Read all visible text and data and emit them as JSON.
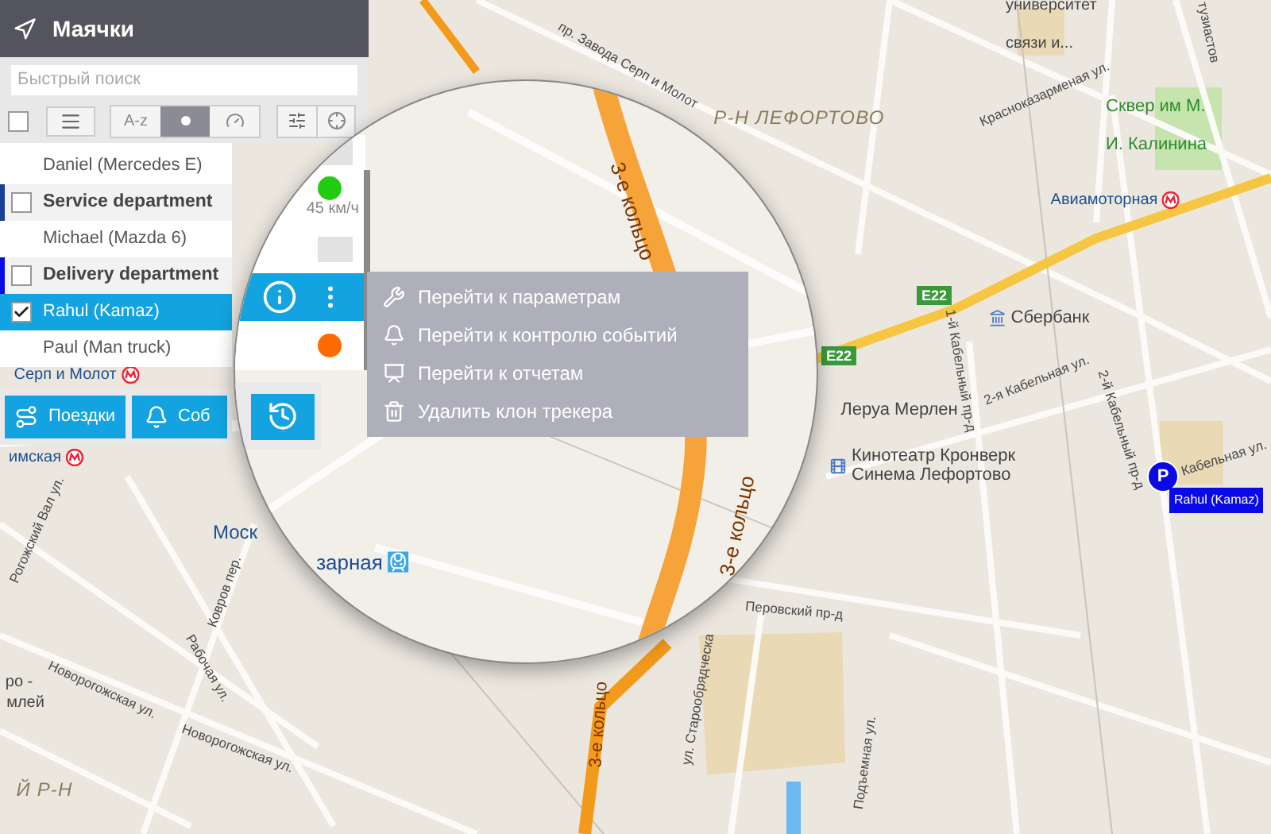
{
  "sidebar": {
    "title": "Маячки",
    "search": {
      "placeholder": "Быстрый поиск"
    },
    "toolbar": {
      "select_all": {
        "checked": false
      },
      "sort_options": [
        {
          "kind": "text",
          "label": "A-z",
          "selected": false
        },
        {
          "kind": "dot",
          "selected": true
        },
        {
          "kind": "gauge",
          "selected": false
        }
      ]
    },
    "list": [
      {
        "kind": "tracker",
        "name": "Daniel (Mercedes E)",
        "checked": false,
        "selected": false
      },
      {
        "kind": "group",
        "name": "Service department",
        "checked": false,
        "selected": false,
        "color": "#1c3f94"
      },
      {
        "kind": "tracker",
        "name": "Michael (Mazda 6)",
        "checked": false,
        "selected": false
      },
      {
        "kind": "group",
        "name": "Delivery department",
        "checked": false,
        "selected": false,
        "color": "#0a0ae6"
      },
      {
        "kind": "tracker",
        "name": "Rahul (Kamaz)",
        "checked": true,
        "selected": true
      },
      {
        "kind": "tracker",
        "name": "Paul (Man truck)",
        "checked": false,
        "selected": false
      }
    ],
    "bottom_buttons": [
      {
        "kind": "trips",
        "label": "Поездки"
      },
      {
        "kind": "events",
        "label": "Соб"
      }
    ]
  },
  "magnifier": {
    "buttons": [
      {
        "kind": "history"
      }
    ],
    "rows": [
      {
        "kind": "bubble"
      },
      {
        "kind": "status",
        "color": "#22cc11",
        "speed": "45 км/ч"
      },
      {
        "kind": "bubble"
      },
      {
        "kind": "actions",
        "selected": true
      },
      {
        "kind": "status",
        "color": "#ff6a00"
      }
    ],
    "map_labels": [
      {
        "kind": "ring",
        "text": "3-е кольцо"
      },
      {
        "kind": "ring",
        "text": "3-е кольцо"
      },
      {
        "kind": "station",
        "text": "зарная"
      }
    ]
  },
  "context_menu": {
    "items": [
      {
        "kind": "wrench",
        "label": "Перейти к параметрам"
      },
      {
        "kind": "bell",
        "label": "Перейти к контролю событий"
      },
      {
        "kind": "report",
        "label": "Перейти к отчетам"
      },
      {
        "kind": "trash",
        "label": "Удалить клон трекера"
      }
    ]
  },
  "map": {
    "labels": [
      {
        "kind": "street",
        "text": "тузиастов"
      },
      {
        "kind": "poi",
        "text": "университет связи и..."
      },
      {
        "kind": "street",
        "text": "пр. Завода Серп и Молот"
      },
      {
        "kind": "street",
        "text": "Красноказарменая ул."
      },
      {
        "kind": "district",
        "text": "Р-Н ЛЕФОРТОВО"
      },
      {
        "kind": "park",
        "text": "Сквер им М. И. Калинина"
      },
      {
        "kind": "metro",
        "text": "Авиамоторная"
      },
      {
        "kind": "highway",
        "text": "E22"
      },
      {
        "kind": "bank",
        "text": "Сбербанк"
      },
      {
        "kind": "highway",
        "text": "E22"
      },
      {
        "kind": "street",
        "text": "1-й Кабельный пр-д"
      },
      {
        "kind": "metro",
        "text": "Серп и Молот"
      },
      {
        "kind": "street",
        "text": "2-я Кабельная ул."
      },
      {
        "kind": "shop",
        "text": "Леруа Мерлен"
      },
      {
        "kind": "street",
        "text": "2-й Кабельный пр-д"
      },
      {
        "kind": "street",
        "text": "Кабельная ул."
      },
      {
        "kind": "metro",
        "text": "имская"
      },
      {
        "kind": "cinema",
        "text": "Кинотеатр Кронверк Синема Лефортово"
      },
      {
        "kind": "street",
        "text": "Рогожский Вал ул."
      },
      {
        "kind": "station",
        "text": "Моск"
      },
      {
        "kind": "street",
        "text": "Ковров пер."
      },
      {
        "kind": "street",
        "text": "Перовский пр-д"
      },
      {
        "kind": "street",
        "text": "Рабочая ул."
      },
      {
        "kind": "poi",
        "text": "ро -"
      },
      {
        "kind": "street",
        "text": "Новорогожская ул."
      },
      {
        "kind": "street",
        "text": "ул. Старообрядческа"
      },
      {
        "kind": "poi",
        "text": "млей"
      },
      {
        "kind": "ring",
        "text": "3-е кольцо"
      },
      {
        "kind": "street",
        "text": "Новорогожская ул."
      },
      {
        "kind": "street",
        "text": "Подъемная ул."
      },
      {
        "kind": "district",
        "text": "Й Р-Н"
      }
    ],
    "markers": [
      {
        "letter": "P",
        "label": "Rahul (Kamaz)"
      }
    ]
  }
}
